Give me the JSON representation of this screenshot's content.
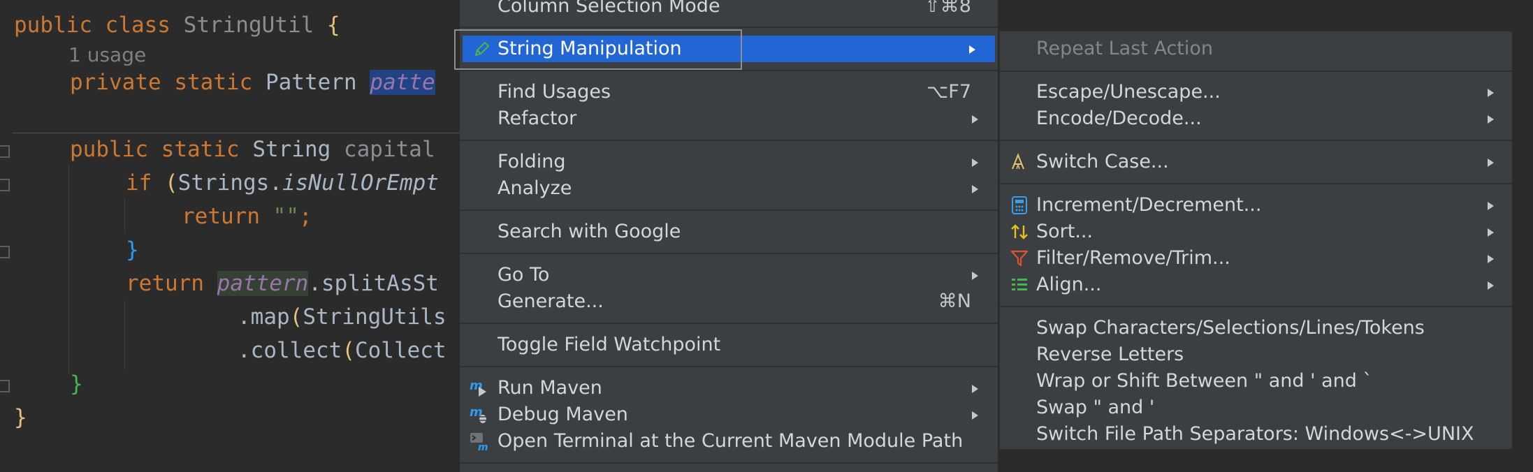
{
  "editor": {
    "line1": {
      "kw1": "public",
      "kw2": "class",
      "name": "StringUtil",
      "brace": "{"
    },
    "usage_hint": "1 usage",
    "line3": {
      "kw1": "private",
      "kw2": "static",
      "type": "Pattern",
      "field": "patte"
    },
    "line4": {
      "kw1": "public",
      "kw2": "static",
      "type": "String",
      "method": "capital"
    },
    "line5": {
      "kw": "if",
      "paren": "(",
      "obj": "Strings.",
      "call": "isNullOrEmpt"
    },
    "line6": {
      "kw": "return",
      "str": "\"\"",
      "semi": ";"
    },
    "line7": {
      "brace": "}"
    },
    "line8": {
      "kw": "return",
      "field": "pattern",
      "call": ".splitAsSt"
    },
    "line9": {
      "dot": ".map",
      "paren": "(",
      "rest": "StringUtils"
    },
    "line10": {
      "dot": ".collect",
      "paren": "(",
      "rest": "Collect"
    },
    "line11": {
      "brace": "}"
    },
    "line12": {
      "brace": "}"
    }
  },
  "context_menu": {
    "items": [
      {
        "label": "Column Selection Mode",
        "shortcut": "⇧⌘8"
      },
      {
        "label": "String Manipulation",
        "icon": "pencil-icon"
      },
      {
        "label": "Find Usages",
        "shortcut": "⌥F7"
      },
      {
        "label": "Refactor"
      },
      {
        "label": "Folding"
      },
      {
        "label": "Analyze"
      },
      {
        "label": "Search with Google"
      },
      {
        "label": "Go To"
      },
      {
        "label": "Generate...",
        "shortcut": "⌘N"
      },
      {
        "label": "Toggle Field Watchpoint"
      },
      {
        "label": "Run Maven",
        "icon": "maven-run-icon"
      },
      {
        "label": "Debug Maven",
        "icon": "maven-debug-icon"
      },
      {
        "label": "Open Terminal at the Current Maven Module Path",
        "icon": "maven-terminal-icon"
      }
    ]
  },
  "submenu": {
    "items": [
      {
        "label": "Repeat Last Action"
      },
      {
        "label": "Escape/Unescape..."
      },
      {
        "label": "Encode/Decode..."
      },
      {
        "label": "Switch Case...",
        "icon": "switch-case-icon"
      },
      {
        "label": "Increment/Decrement...",
        "icon": "calculator-icon"
      },
      {
        "label": "Sort...",
        "icon": "sort-icon"
      },
      {
        "label": "Filter/Remove/Trim...",
        "icon": "filter-icon"
      },
      {
        "label": "Align...",
        "icon": "align-icon"
      },
      {
        "label": "Swap Characters/Selections/Lines/Tokens"
      },
      {
        "label": "Reverse Letters"
      },
      {
        "label": "Wrap or Shift Between \" and ' and `"
      },
      {
        "label": "Swap \" and '"
      },
      {
        "label": "Switch File Path Separators: Windows<->UNIX"
      }
    ]
  },
  "colors": {
    "highlight": "#2266d6",
    "menu_bg": "#3c3f41",
    "editor_bg": "#2b2b2b"
  }
}
